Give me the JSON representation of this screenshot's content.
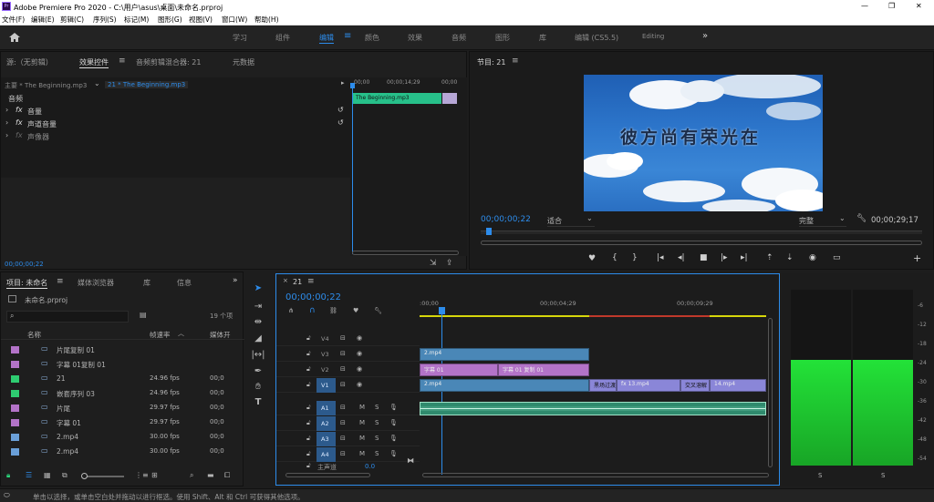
{
  "colors": {
    "accent": "#2d8ceb",
    "clip_blue": "#4a87b7",
    "clip_purple": "#b373c8",
    "clip_audio": "#2f8a6d",
    "clip_lavender": "#8a86d8",
    "meter_green": "#19c82e",
    "header_green": "#2ecc71"
  },
  "titlebar": {
    "title": "Adobe Premiere Pro 2020 - C:\\用户\\asus\\桌面\\未命名.prproj",
    "app_icon": "premiere-pro-logo"
  },
  "window_controls": {
    "minimize": "—",
    "maximize": "❐",
    "close": "✕"
  },
  "menu": [
    "文件(F)",
    "编辑(E)",
    "剪辑(C)",
    "序列(S)",
    "标记(M)",
    "图形(G)",
    "视图(V)",
    "窗口(W)",
    "帮助(H)"
  ],
  "workspaces": {
    "items": [
      "学习",
      "组件",
      "编辑",
      "颜色",
      "效果",
      "音频",
      "图形",
      "库",
      "编辑 (CS5.5)",
      "Editing"
    ],
    "active": "编辑",
    "more": "»"
  },
  "source_panel": {
    "tabs": [
      "源:（无剪辑）",
      "效果控件",
      "音频剪辑混合器: 21",
      "元数据"
    ],
    "active_tab": "效果控件",
    "sequence_path": "主要 * The Beginning.mp3",
    "clip_path": "21 * The Beginning.mp3",
    "section": "音频",
    "effects": [
      "音量",
      "声道音量",
      "声像器"
    ],
    "mini_ruler": [
      "00;00",
      "00;00;14;29",
      "00;00"
    ],
    "mini_clip": "The Beginning.mp3",
    "timecode": "00;00;00;22"
  },
  "program_monitor": {
    "title": "节目: 21",
    "overlay_text": "彼方尚有荣光在",
    "timecode": "00;00;00;22",
    "fit": "适合",
    "quality": "完整",
    "duration": "00;00;29;17"
  },
  "project_panel": {
    "tabs": [
      "项目: 未命名",
      "媒体浏览器",
      "库",
      "信息"
    ],
    "file": "未命名.prproj",
    "item_count": "19 个项",
    "columns": [
      "名称",
      "帧速率",
      "媒体开"
    ],
    "items": [
      {
        "color": "#b373c8",
        "name": "片尾复制 01",
        "fps": "",
        "start": ""
      },
      {
        "color": "#b373c8",
        "name": "字幕 01复制 01",
        "fps": "",
        "start": ""
      },
      {
        "color": "#2ecc71",
        "name": "21",
        "fps": "24.96 fps",
        "start": "00;0"
      },
      {
        "color": "#2ecc71",
        "name": "嵌套序列 03",
        "fps": "24.96 fps",
        "start": "00;0"
      },
      {
        "color": "#b373c8",
        "name": "片尾",
        "fps": "29.97 fps",
        "start": "00;0"
      },
      {
        "color": "#b373c8",
        "name": "字幕 01",
        "fps": "29.97 fps",
        "start": "00;0"
      },
      {
        "color": "#6a9fd8",
        "name": "2.mp4",
        "fps": "30.00 fps",
        "start": "00;0"
      },
      {
        "color": "#6a9fd8",
        "name": "2.mp4",
        "fps": "30.00 fps",
        "start": "00;0"
      }
    ]
  },
  "timeline": {
    "tab": "21",
    "timecode": "00;00;00;22",
    "ruler": [
      ":00;00",
      "00;00;04;29",
      "00;00;09;29"
    ],
    "video_tracks": [
      "V4",
      "V3",
      "V2",
      "V1"
    ],
    "audio_tracks": [
      "A1",
      "A2",
      "A3",
      "A4"
    ],
    "master": "主声道",
    "master_value": "0.0",
    "track_buttons": {
      "mute": "M",
      "solo": "S"
    },
    "clips": {
      "v3": [
        "2.mp4"
      ],
      "v2": [
        "字幕 01",
        "字幕 01 复制 01"
      ],
      "v1": [
        "2.mp4",
        "黑场过渡",
        "fx 13.mp4",
        "交叉溶解",
        "14.mp4"
      ],
      "a1": [
        "2.mp4"
      ]
    }
  },
  "meters": {
    "scale": [
      "-6",
      "-12",
      "-18",
      "-24",
      "-30",
      "-36",
      "-42",
      "-48",
      "-54"
    ],
    "labels": [
      "S",
      "S"
    ],
    "left_level": 0.6,
    "right_level": 0.6
  },
  "statusbar": {
    "text": "单击以选择，或单击空白处并拖动以进行框选。使用 Shift、Alt 和 Ctrl 可获得其他选项。"
  }
}
